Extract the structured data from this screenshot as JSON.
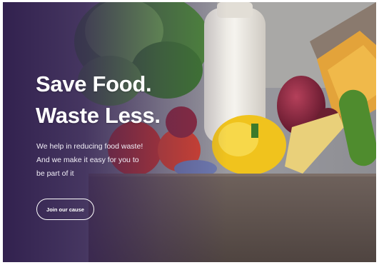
{
  "hero": {
    "headline_line1": "Save Food.",
    "headline_line2": "Waste Less.",
    "tagline_line1": "We help in reducing food waste!",
    "tagline_line2": "And we make it easy for you to",
    "tagline_line3": "be part of it",
    "cta_label": "Join our cause",
    "background_image": "grocery-box-photo",
    "overlay_color": "#2c1a4a",
    "text_color": "#ffffff"
  }
}
